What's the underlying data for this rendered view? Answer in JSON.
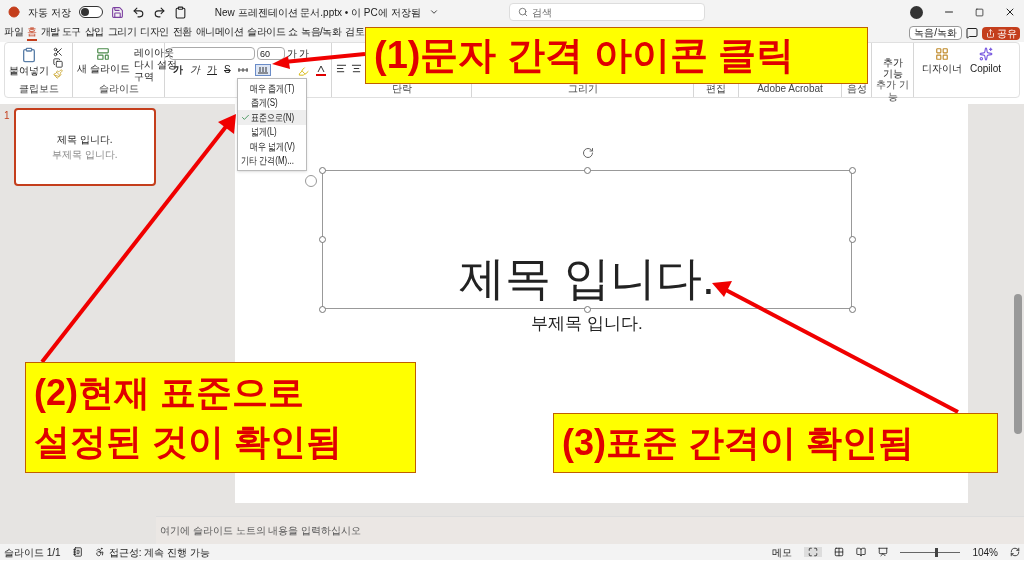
{
  "title_bar": {
    "autosave_label": "자동 저장",
    "autosave_on": false,
    "document_title": "New 프레젠테이션 문서.pptx • 이 PC에 저장됨",
    "search_placeholder": "검색"
  },
  "menu_tabs": [
    {
      "label": "파일",
      "selected": false
    },
    {
      "label": "홈",
      "selected": true
    },
    {
      "label": "개발 도구",
      "selected": false
    },
    {
      "label": "삽입",
      "selected": false
    },
    {
      "label": "그리기",
      "selected": false
    },
    {
      "label": "디자인",
      "selected": false
    },
    {
      "label": "전환",
      "selected": false
    },
    {
      "label": "애니메이션",
      "selected": false
    },
    {
      "label": "슬라이드 쇼",
      "selected": false
    },
    {
      "label": "녹음/녹화",
      "selected": false
    },
    {
      "label": "검토",
      "selected": false
    }
  ],
  "ribbon_actions": {
    "record_button": "녹음/녹화",
    "share_button": "공유"
  },
  "ribbon": {
    "clipboard": {
      "paste_button": "붙여넣기",
      "label": "클립보드"
    },
    "slides": {
      "new_slide_button": "새 슬라이드",
      "commands": [
        "레이아웃",
        "다시 설정",
        "구역"
      ],
      "label": "슬라이드"
    },
    "font": {
      "font_size": "60",
      "grow_button": "가",
      "shrink_button": "가",
      "style_buttons": [
        "가",
        "가",
        "가",
        "S"
      ]
    },
    "paragraph": {
      "label": "단락"
    },
    "drawing": {
      "label": "그리기"
    },
    "editing": {
      "label": "편집"
    },
    "acrobat": {
      "label": "Adobe Acrobat"
    },
    "voice": {
      "label": "음성"
    },
    "add_ins": {
      "button": "추가 기능",
      "label": "추가 기능"
    },
    "designer_button": "디자이너",
    "copilot_button": "Copilot"
  },
  "spacing_menu": [
    {
      "label": "매우 좁게(T)",
      "selected": false
    },
    {
      "label": "좁게(S)",
      "selected": false
    },
    {
      "label": "표준으로(N)",
      "selected": true
    },
    {
      "label": "넓게(L)",
      "selected": false
    },
    {
      "label": "매우 넓게(V)",
      "selected": false
    },
    {
      "label": "기타 간격(M)...",
      "selected": false
    }
  ],
  "thumbnails": [
    {
      "number": "1",
      "title": "제목 입니다.",
      "subtitle": "부제목 입니다.",
      "selected": true
    }
  ],
  "slide": {
    "title": "제목 입니다.",
    "subtitle": "부제목 입니다."
  },
  "notes_placeholder": "여기에 슬라이드 노트의 내용을 입력하십시오",
  "status_bar": {
    "slide_position": "슬라이드 1/1",
    "accessibility": "접근성: 계속 진행 가능",
    "notes_button": "메모",
    "zoom": {
      "level": 0.6,
      "reading": "104%"
    }
  },
  "annotations": [
    {
      "lines": [
        "(1)문자 간격 아이콘 클릭"
      ]
    },
    {
      "lines": [
        "(2)현재 표준으로",
        "설정된 것이 확인됨"
      ]
    },
    {
      "lines": [
        "(3)표준 간격이 확인됨"
      ]
    }
  ]
}
